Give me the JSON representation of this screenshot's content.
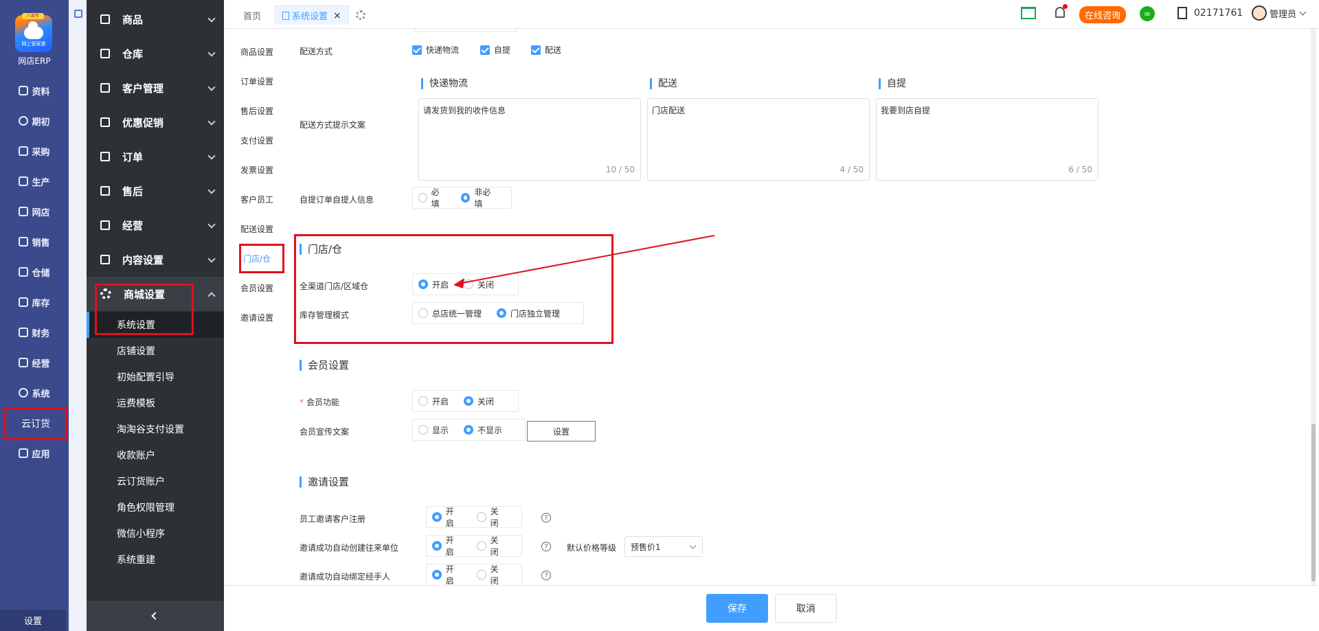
{
  "rail": {
    "logo_badge": "八周年",
    "logo_tag": "网上管家婆",
    "logo_name": "网店ERP",
    "items": [
      {
        "label": "资料",
        "icon": "profile-icon"
      },
      {
        "label": "期初",
        "icon": "clock-icon"
      },
      {
        "label": "采购",
        "icon": "purchase-icon"
      },
      {
        "label": "生产",
        "icon": "production-icon"
      },
      {
        "label": "网店",
        "icon": "shop-icon"
      },
      {
        "label": "销售",
        "icon": "sales-icon"
      },
      {
        "label": "仓储",
        "icon": "storage-icon"
      },
      {
        "label": "库存",
        "icon": "inventory-icon"
      },
      {
        "label": "财务",
        "icon": "finance-icon"
      },
      {
        "label": "经营",
        "icon": "operation-icon"
      },
      {
        "label": "系统",
        "icon": "system-icon"
      }
    ],
    "yun": "云订货",
    "apps": "应用",
    "settings": "设置"
  },
  "sidebar": {
    "menus": [
      {
        "label": "商品"
      },
      {
        "label": "仓库"
      },
      {
        "label": "客户管理"
      },
      {
        "label": "优惠促销"
      },
      {
        "label": "订单"
      },
      {
        "label": "售后"
      },
      {
        "label": "经营"
      },
      {
        "label": "内容设置"
      },
      {
        "label": "商城设置"
      }
    ],
    "sub_items": [
      {
        "label": "系统设置"
      },
      {
        "label": "店铺设置"
      },
      {
        "label": "初始配置引导"
      },
      {
        "label": "运费模板"
      },
      {
        "label": "淘淘谷支付设置"
      },
      {
        "label": "收款账户"
      },
      {
        "label": "云订货账户"
      },
      {
        "label": "角色权限管理"
      },
      {
        "label": "微信小程序"
      },
      {
        "label": "系统重建"
      }
    ]
  },
  "topbar": {
    "tabs": [
      {
        "label": "首页"
      },
      {
        "label": "系统设置"
      }
    ],
    "close": "×",
    "consult": "在线咨询",
    "phone": "02171761",
    "user": "管理员"
  },
  "subnav": [
    "商品设置",
    "订单设置",
    "售后设置",
    "支付设置",
    "发票设置",
    "客户员工",
    "配送设置",
    "门店/仓",
    "会员设置",
    "邀请设置"
  ],
  "delivery": {
    "method_label": "配送方式",
    "methods": [
      "快递物流",
      "自提",
      "配送"
    ],
    "tip_label": "配送方式提示文案",
    "cards": [
      {
        "title": "快递物流",
        "text": "请发货到我的收件信息",
        "count": "10 / 50"
      },
      {
        "title": "配送",
        "text": "门店配送",
        "count": "4 / 50"
      },
      {
        "title": "自提",
        "text": "我要到店自提",
        "count": "6 / 50"
      }
    ],
    "pickup_label": "自提订单自提人信息",
    "pickup_options": [
      "必填",
      "非必填"
    ]
  },
  "store": {
    "title": "门店/仓",
    "omni_label": "全渠道门店/区域仓",
    "omni_options": [
      "开启",
      "关闭"
    ],
    "stock_label": "库存管理模式",
    "stock_options": [
      "总店统一管理",
      "门店独立管理"
    ]
  },
  "member": {
    "title": "会员设置",
    "func_label": "会员功能",
    "func_options": [
      "开启",
      "关闭"
    ],
    "promo_label": "会员宣传文案",
    "promo_options": [
      "显示",
      "不显示"
    ],
    "set_button": "设置"
  },
  "invite": {
    "title": "邀请设置",
    "rows": [
      {
        "label": "员工邀请客户注册",
        "options": [
          "开启",
          "关闭"
        ]
      },
      {
        "label": "邀请成功自动创建往来单位",
        "options": [
          "开启",
          "关闭"
        ]
      },
      {
        "label": "邀请成功自动绑定经手人",
        "options": [
          "开启",
          "关闭"
        ]
      }
    ],
    "price_label": "默认价格等级",
    "price_value": "预售价1",
    "help": "?"
  },
  "footer": {
    "save": "保存",
    "cancel": "取消"
  },
  "colors": {
    "accent": "#409eff",
    "annotation": "#e0101e",
    "rail": "#3b4a8c",
    "sidebar": "#2d3136"
  }
}
